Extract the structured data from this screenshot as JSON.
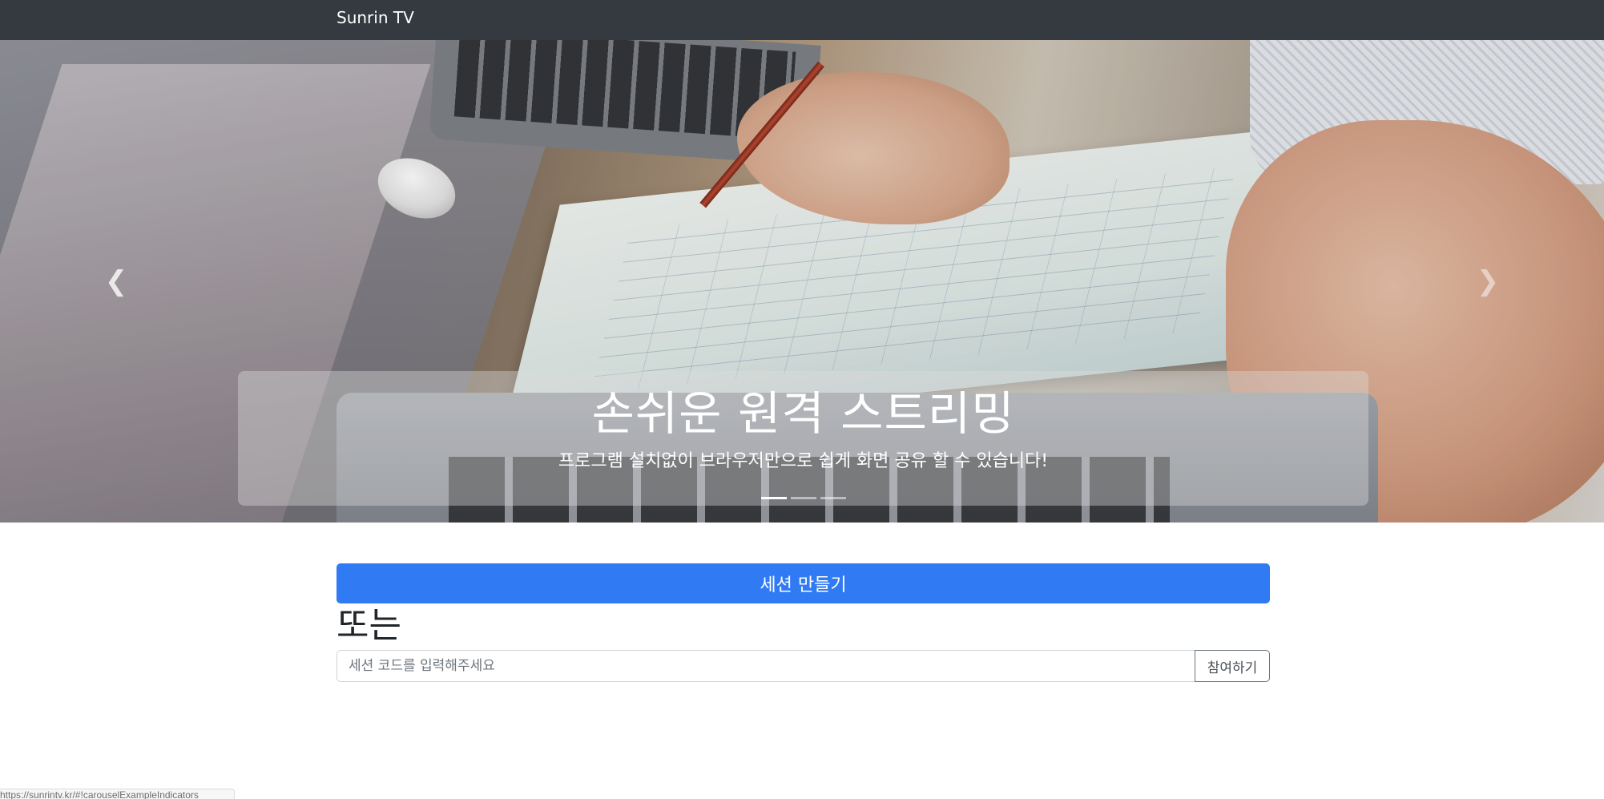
{
  "navbar": {
    "brand": "Sunrin TV"
  },
  "carousel": {
    "title": "손쉬운 원격 스트리밍",
    "subtitle": "프로그램 설치없이 브라우저만으로 쉽게 화면 공유 할 수 있습니다!",
    "active_slide": 1,
    "slide_count": 3
  },
  "main": {
    "create_button": "세션 만들기",
    "or_label": "또는",
    "code_placeholder": "세션 코드를 입력해주세요",
    "join_button": "참여하기"
  },
  "status_bar": {
    "url": "https://sunrintv.kr/#!carouselExampleIndicators"
  },
  "colors": {
    "navbar": "#343a40",
    "primary": "#307bf4"
  }
}
